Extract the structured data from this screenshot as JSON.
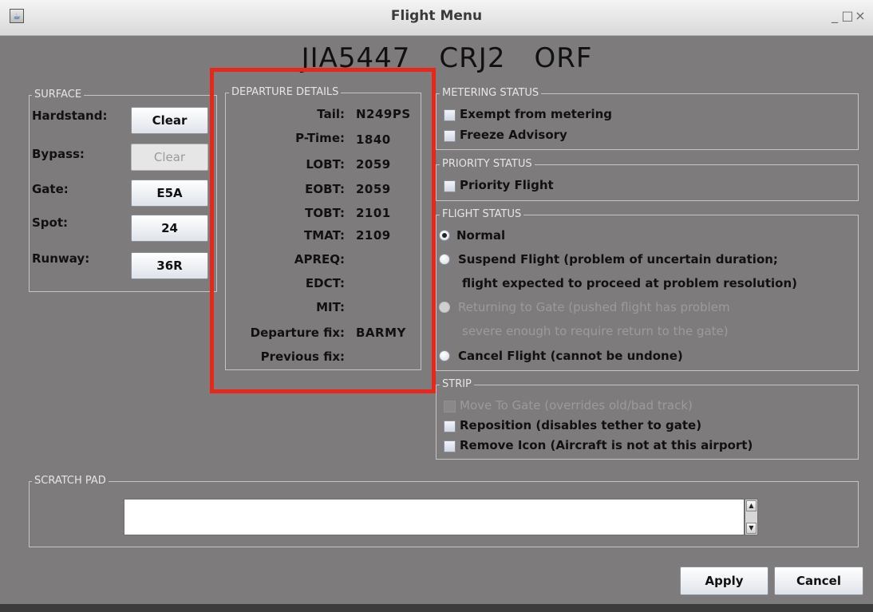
{
  "window": {
    "title": "Flight Menu",
    "minimize_glyph": "_",
    "maximize_glyph": "□",
    "close_glyph": "×"
  },
  "flight": {
    "callsign": "JIA5447",
    "aircraft": "CRJ2",
    "destination": "ORF"
  },
  "surface": {
    "legend": "SURFACE",
    "rows": [
      {
        "label": "Hardstand:",
        "button": "Clear"
      },
      {
        "label": "Bypass:",
        "button": "Clear",
        "disabled": true
      },
      {
        "label": "Gate:",
        "button": "E5A"
      },
      {
        "label": "Spot:",
        "button": "24"
      },
      {
        "label": "Runway:",
        "button": "36R"
      }
    ]
  },
  "departure_details": {
    "legend": "DEPARTURE DETAILS",
    "rows": [
      {
        "label": "Tail:",
        "value": "N249PS"
      },
      {
        "label": "P-Time:",
        "value": "1840"
      },
      {
        "label": "LOBT:",
        "value": "2059"
      },
      {
        "label": "EOBT:",
        "value": "2059"
      },
      {
        "label": "TOBT:",
        "value": "2101"
      },
      {
        "label": "TMAT:",
        "value": "2109"
      },
      {
        "label": "APREQ:",
        "value": ""
      },
      {
        "label": "EDCT:",
        "value": ""
      },
      {
        "label": "MIT:",
        "value": ""
      },
      {
        "label": "Departure fix:",
        "value": "BARMY"
      },
      {
        "label": "Previous fix:",
        "value": ""
      }
    ]
  },
  "metering_status": {
    "legend": "METERING STATUS",
    "options": [
      "Exempt from metering",
      "Freeze Advisory"
    ]
  },
  "priority_status": {
    "legend": "PRIORITY STATUS",
    "options": [
      "Priority Flight"
    ]
  },
  "flight_status": {
    "legend": "FLIGHT STATUS",
    "normal": "Normal",
    "suspend_line1": "Suspend Flight (problem of uncertain duration;",
    "suspend_line2": "flight expected to proceed at problem resolution)",
    "returning_line1": "Returning to Gate (pushed flight has problem",
    "returning_line2": "severe enough to require return to the gate)",
    "cancel": "Cancel Flight (cannot be undone)",
    "selected": "Normal"
  },
  "strip": {
    "legend": "STRIP",
    "move_to_gate": "Move To Gate (overrides old/bad track)",
    "reposition": "Reposition (disables tether to gate)",
    "remove_icon": "Remove Icon (Aircraft is not at this airport)"
  },
  "scratch_pad": {
    "legend": "SCRATCH PAD",
    "value": ""
  },
  "footer": {
    "apply": "Apply",
    "cancel": "Cancel"
  },
  "colors": {
    "background": "#7d7b7c",
    "highlight_box": "#e8261c"
  }
}
